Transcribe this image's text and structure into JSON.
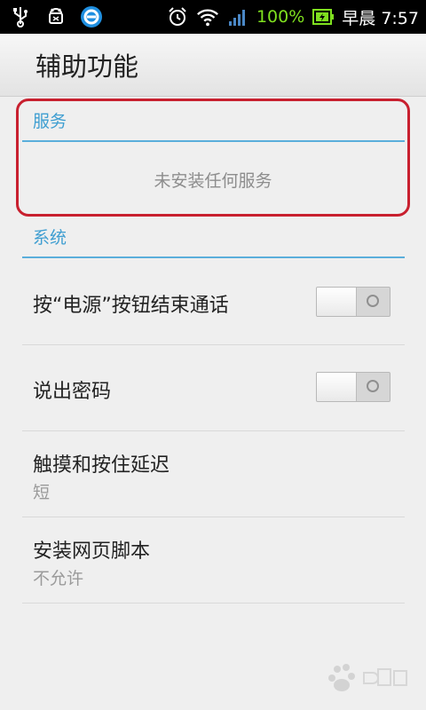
{
  "status_bar": {
    "icons_left": [
      "usb-icon",
      "android-debug-icon",
      "browser-app-icon"
    ],
    "icons_right": [
      "alarm-icon",
      "wifi-icon",
      "signal-icon",
      "battery-icon"
    ],
    "battery": "100%",
    "time": "早晨 7:57",
    "battery_color": "#7fe01f"
  },
  "title_bar": {
    "title": "辅助功能"
  },
  "sections": {
    "services": {
      "header": "服务",
      "empty_message": "未安装任何服务"
    },
    "system": {
      "header": "系统",
      "items": [
        {
          "title": "按“电源”按钮结束通话",
          "toggle": false
        },
        {
          "title": "说出密码",
          "toggle": false
        },
        {
          "title": "触摸和按住延迟",
          "summary": "短"
        },
        {
          "title": "安装网页脚本",
          "summary": "不允许"
        }
      ]
    }
  },
  "colors": {
    "accent": "#3f9ed1",
    "highlight_annotation": "#c8202f"
  }
}
